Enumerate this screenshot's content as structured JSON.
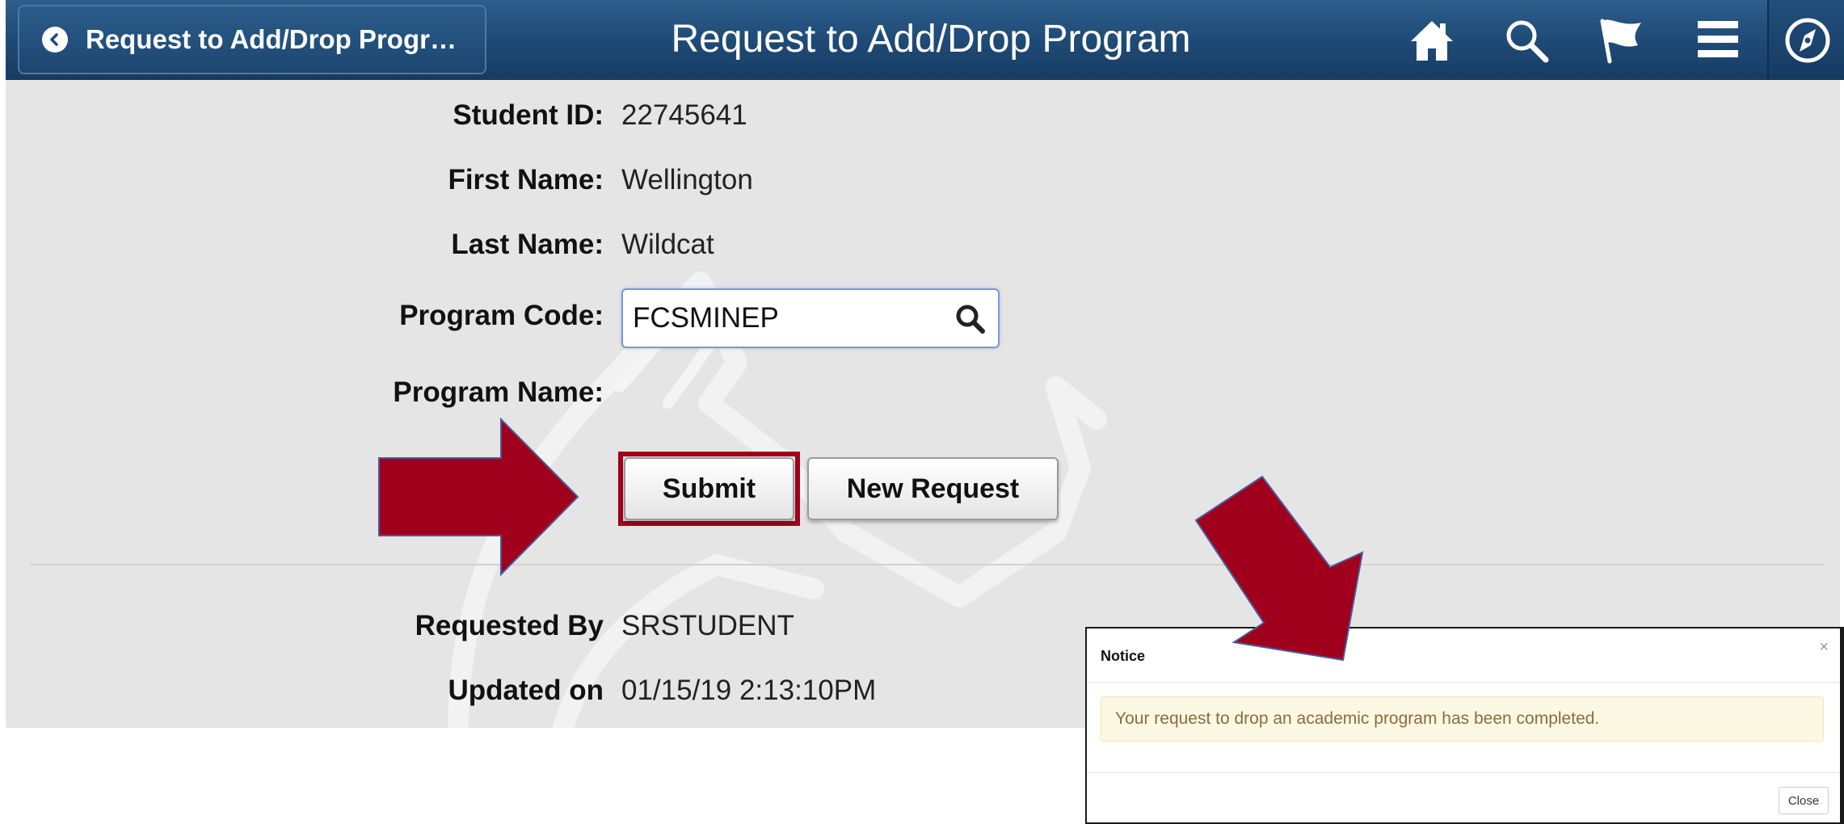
{
  "header": {
    "back_label": "Request to Add/Drop Progr…",
    "title": "Request to Add/Drop Program",
    "icons": [
      "home-icon",
      "search-icon",
      "flag-icon",
      "menu-icon",
      "compass-icon"
    ]
  },
  "form": {
    "student_id_label": "Student ID:",
    "student_id": "22745641",
    "first_name_label": "First Name:",
    "first_name": "Wellington",
    "last_name_label": "Last Name:",
    "last_name": "Wildcat",
    "program_code_label": "Program Code:",
    "program_code": "FCSMINEP",
    "program_name_label": "Program Name:",
    "program_name": "",
    "submit_label": "Submit",
    "new_request_label": "New Request",
    "requested_by_label": "Requested By",
    "requested_by": "SRSTUDENT",
    "updated_on_label": "Updated on",
    "updated_on": "01/15/19  2:13:10PM"
  },
  "modal": {
    "title": "Notice",
    "close_x": "×",
    "message": "Your request to drop an academic program has been completed.",
    "close_label": "Close"
  },
  "colors": {
    "header_blue": "#1f4b77",
    "arrow_red": "#a0001c",
    "alert_bg": "#fcf8e3",
    "alert_text": "#8a6d3b"
  }
}
